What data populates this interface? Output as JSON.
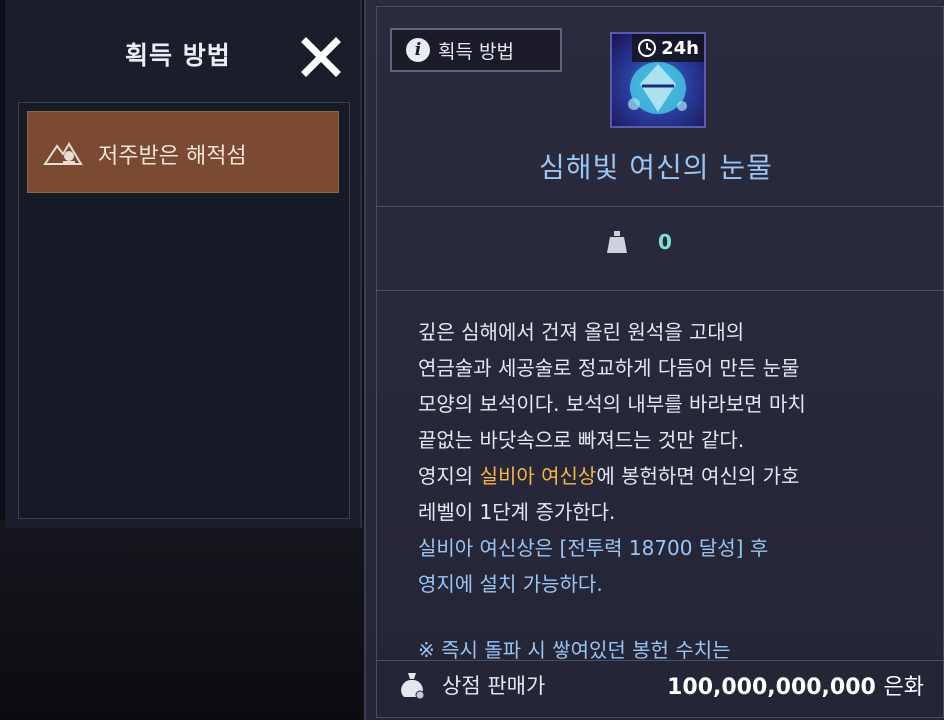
{
  "left": {
    "title": "획득 방법",
    "sources": [
      {
        "label": "저주받은 해적섬"
      }
    ]
  },
  "right": {
    "acquire_button": "획득 방법",
    "timer": "24h",
    "item_name": "심해빛 여신의 눈물",
    "weight": "0",
    "description": {
      "line1": "깊은 심해에서 건져 올린 원석을 고대의",
      "line2": "연금술과 세공술로 정교하게 다듬어 만든 눈물",
      "line3": "모양의 보석이다. 보석의 내부를 바라보면 마치",
      "line4": "끝없는 바닷속으로 빠져드는 것만 같다.",
      "line5_prefix": "영지의 ",
      "line5_highlight": "실비아 여신상",
      "line5_suffix": "에 봉헌하면 여신의 가호",
      "line6": "레벨이 1단계 증가한다.",
      "line7": "실비아 여신상은 [전투력 18700 달성] 후",
      "line8": "영지에 설치 가능하다.",
      "line9": "※ 즉시 돌파 시 쌓여있던 봉헌 수치는"
    },
    "shop": {
      "label": "상점 판매가",
      "price": "100,000,000,000",
      "unit": "은화"
    }
  },
  "colors": {
    "item_name": "#9ac4f2",
    "highlight": "#f3b843",
    "weight": "#7fe2da",
    "source_item_bg": "#7a4a32"
  },
  "icons": [
    "close-icon",
    "mountain-pirate-icon",
    "info-icon",
    "clock-icon",
    "weight-icon",
    "money-bag-icon"
  ]
}
